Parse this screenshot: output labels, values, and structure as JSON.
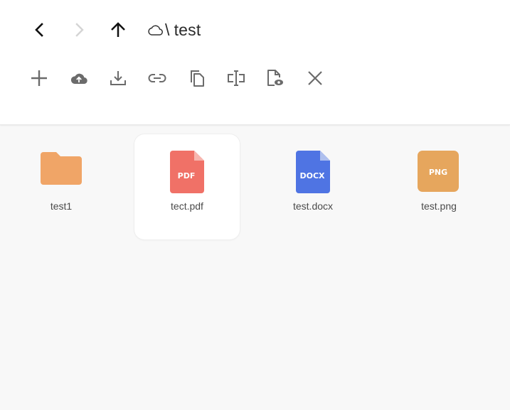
{
  "navigation": {
    "back_icon": "chevron-left-icon",
    "forward_icon": "chevron-right-icon",
    "up_icon": "arrow-up-icon"
  },
  "path": {
    "root_icon": "cloud-icon",
    "separator": "\\",
    "current_folder": "test"
  },
  "toolbar": [
    {
      "icon": "plus-icon"
    },
    {
      "icon": "cloud-upload-icon"
    },
    {
      "icon": "download-icon"
    },
    {
      "icon": "link-icon"
    },
    {
      "icon": "copy-icon"
    },
    {
      "icon": "rename-icon"
    },
    {
      "icon": "preview-file-icon"
    },
    {
      "icon": "close-icon"
    }
  ],
  "files": [
    {
      "name": "test1",
      "type": "folder",
      "color": "#f0a567"
    },
    {
      "name": "tect.pdf",
      "type": "pdf",
      "badge": "PDF",
      "color": "#f07167",
      "selected": true
    },
    {
      "name": "test.docx",
      "type": "docx",
      "badge": "DOCX",
      "color": "#4f74e3"
    },
    {
      "name": "test.png",
      "type": "png",
      "badge": "PNG",
      "color": "#e6a65d"
    }
  ]
}
